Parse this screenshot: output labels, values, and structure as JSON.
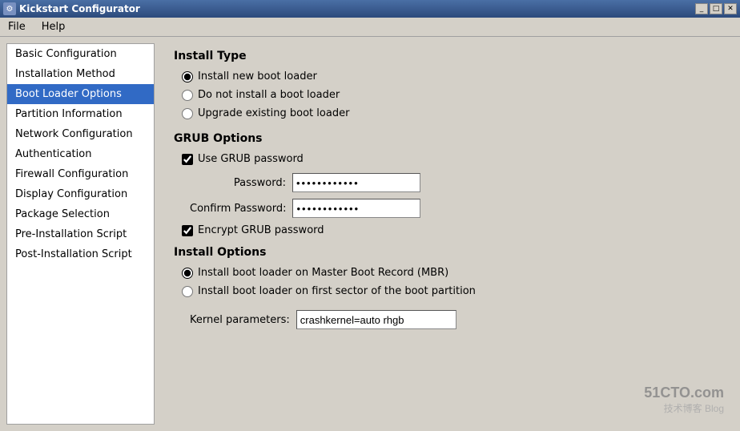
{
  "titlebar": {
    "title": "Kickstart Configurator",
    "minimize_label": "_",
    "maximize_label": "□",
    "close_label": "✕"
  },
  "menubar": {
    "file_label": "File",
    "help_label": "Help"
  },
  "sidebar": {
    "items": [
      {
        "id": "basic",
        "label": "Basic Configuration",
        "active": false
      },
      {
        "id": "install-method",
        "label": "Installation Method",
        "active": false
      },
      {
        "id": "boot-loader",
        "label": "Boot Loader Options",
        "active": true
      },
      {
        "id": "partition",
        "label": "Partition Information",
        "active": false
      },
      {
        "id": "network",
        "label": "Network Configuration",
        "active": false
      },
      {
        "id": "auth",
        "label": "Authentication",
        "active": false
      },
      {
        "id": "firewall",
        "label": "Firewall Configuration",
        "active": false
      },
      {
        "id": "display",
        "label": "Display Configuration",
        "active": false
      },
      {
        "id": "packages",
        "label": "Package Selection",
        "active": false
      },
      {
        "id": "pre-install",
        "label": "Pre-Installation Script",
        "active": false
      },
      {
        "id": "post-install",
        "label": "Post-Installation Script",
        "active": false
      }
    ]
  },
  "content": {
    "install_type_title": "Install Type",
    "install_type_options": [
      {
        "id": "new",
        "label": "Install new boot loader",
        "checked": true
      },
      {
        "id": "none",
        "label": "Do not install a boot loader",
        "checked": false
      },
      {
        "id": "upgrade",
        "label": "Upgrade existing boot loader",
        "checked": false
      }
    ],
    "grub_options_title": "GRUB Options",
    "use_grub_password_label": "Use GRUB password",
    "use_grub_password_checked": true,
    "password_label": "Password:",
    "password_value": "●●●●●●●●●●●",
    "confirm_password_label": "Confirm Password:",
    "confirm_password_value": "●●●●●●●●●●",
    "encrypt_grub_label": "Encrypt GRUB password",
    "encrypt_grub_checked": true,
    "install_options_title": "Install Options",
    "install_options": [
      {
        "id": "mbr",
        "label": "Install boot loader on Master Boot Record (MBR)",
        "checked": true
      },
      {
        "id": "first-sector",
        "label": "Install boot loader on first sector of the boot partition",
        "checked": false
      }
    ],
    "kernel_params_label": "Kernel parameters:",
    "kernel_params_value": "crashkernel=auto rhgb"
  },
  "watermark": {
    "main": "51CTO.com",
    "sub": "技术博客  Blog"
  }
}
